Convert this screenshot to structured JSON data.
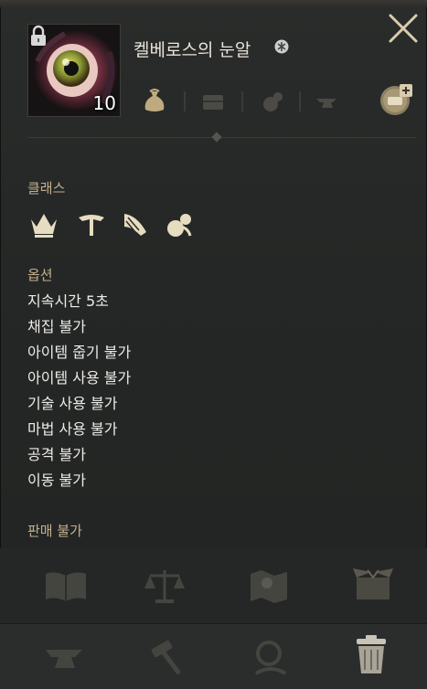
{
  "item": {
    "name": "켈베로스의 눈알",
    "count": "10",
    "icon": "eyeball-item-icon",
    "locked": true
  },
  "header_tools": [
    "money-bag-icon",
    "chest-icon",
    "pouch-icon",
    "anvil-icon"
  ],
  "class_section": {
    "label": "클래스",
    "icons": [
      "warrior-crown-icon",
      "ranger-icon",
      "sorceress-icon",
      "giant-icon"
    ]
  },
  "options_section": {
    "label": "옵션",
    "lines": [
      "지속시간 5초",
      "채집 불가",
      "아이템 줍기 불가",
      "아이템 사용 불가",
      "기술 사용 불가",
      "마법 사용 불가",
      "공격 불가",
      "이동 불가"
    ]
  },
  "sale_label": "판매 불가",
  "actions_row1": [
    "book-icon",
    "scale-icon",
    "map-icon",
    "open-box-icon"
  ],
  "actions_row2": [
    "anvil-icon",
    "hammer-icon",
    "magnifier-icon",
    "trash-can-icon"
  ]
}
